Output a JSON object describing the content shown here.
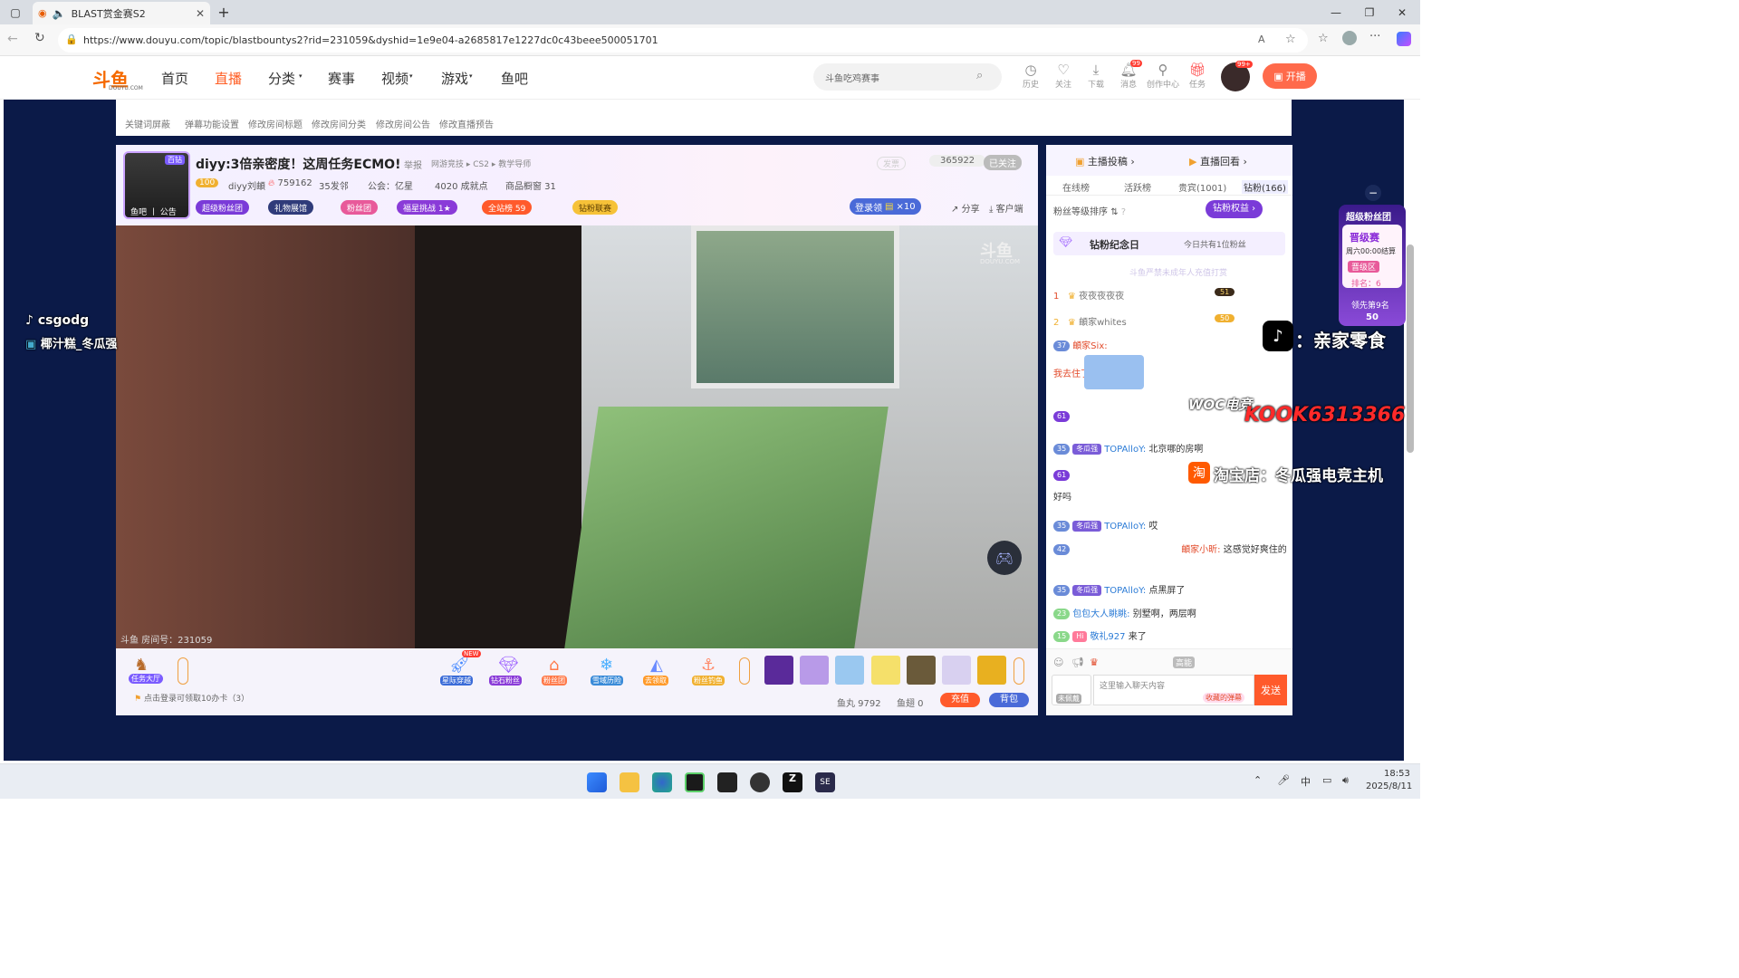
{
  "browser": {
    "tab_title": "BLAST赏金赛S2",
    "url": "https://www.douyu.com/topic/blastbountys2?rid=231059&dyshid=1e9e04-a2685817e1227dc0c43beee500051701"
  },
  "site": {
    "logo": "斗鱼",
    "logo_sub": "DOUYU.COM",
    "nav": [
      "首页",
      "直播",
      "分类",
      "赛事",
      "视频",
      "游戏",
      "鱼吧"
    ],
    "search_placeholder": "斗鱼吃鸡赛事",
    "header_icons": [
      "历史",
      "关注",
      "下载",
      "消息",
      "创作中心",
      "任务"
    ],
    "msg_badge": "99",
    "avatar_badge": "99+",
    "broadcast_btn": "开播"
  },
  "toolrow": [
    "关键词屏蔽",
    "弹幕功能设置",
    "修改房间标题",
    "修改房间分类",
    "修改房间公告",
    "修改直播预告"
  ],
  "room": {
    "title": "diyy:3倍亲密度！这周任务ECMO!",
    "report": "举报",
    "category": "网游竞技 ▸ CS2 ▸ 教学导师",
    "anchor_badge": "百钻",
    "anchor_tabs": "鱼吧 丨 公告",
    "level": "100",
    "anchor_name": "diyy刘頔",
    "hot": "759162",
    "fans_groups": "35发邻",
    "guild": "公会：亿星",
    "achievement": "4020 成就点",
    "shop": "商品橱窗 31",
    "follow_count": "365922",
    "followed": "已关注",
    "vote": "发票",
    "pills": [
      "超级粉丝团",
      "礼物展馆",
      "粉丝团",
      "福星挑战  1★",
      "全站榜   59",
      "钻粉联赛"
    ],
    "login_get": "登录领",
    "x10": "×10",
    "share": "分享",
    "client": "客户端",
    "room_no": "斗鱼 房间号：231059",
    "watermark": "斗鱼",
    "watermark_sub": "DOUYU.COM"
  },
  "bottom": {
    "task_hall": "任务大厅",
    "items": [
      "星际穿越",
      "钻石粉丝",
      "粉丝团",
      "雪域历险",
      "去领取",
      "粉丝钓鱼"
    ],
    "new_tag": "NEW",
    "login_hint": "点击登录可领取10办卡（3）",
    "yuwan": "鱼丸 9792",
    "yuchi": "鱼翅 0",
    "recharge": "充值",
    "backpack": "背包"
  },
  "side": {
    "tab_top": [
      "主播投稿",
      "直播回看"
    ],
    "tabs": [
      "在线榜",
      "活跃榜",
      "贵宾(1001)",
      "钻粉(166)"
    ],
    "fan_sort": "粉丝等级排序",
    "diamond_rights": "钻粉权益",
    "memorial": "钻粉纪念日",
    "memorial_right": "今日共有1位粉丝",
    "watermark_tip": "斗鱼严禁未成年人充值打赏",
    "rank": [
      {
        "no": "1",
        "name": "夜夜夜夜夜",
        "lv": "51"
      },
      {
        "no": "2",
        "name": "頔家whites",
        "lv": "50"
      }
    ],
    "chat": [
      {
        "lv": "37",
        "name": "頔家Six:",
        "text": "我去住了"
      },
      {
        "lv": "61",
        "name": "",
        "text": ""
      },
      {
        "lv": "35",
        "fb": "冬瓜强",
        "name": "TOPAlloY:",
        "text": "北京哪的房啊"
      },
      {
        "lv": "61",
        "name": "",
        "text": "好吗"
      },
      {
        "lv": "35",
        "fb": "冬瓜强",
        "name": "TOPAlloY:",
        "text": "哎"
      },
      {
        "lv": "42",
        "name": "頔家小昕:",
        "text": "这感觉好爽住的"
      },
      {
        "lv": "35",
        "fb": "冬瓜强",
        "name": "TOPAlloY:",
        "text": "点黑屏了"
      },
      {
        "lv": "23",
        "name": "包包大人眺眺:",
        "text": "别墅啊，两层啊"
      },
      {
        "lv": "15",
        "name": "敬礼927",
        "text": "来了"
      }
    ],
    "input_placeholder": "这里输入聊天内容",
    "input_tag": "收藏的弹幕",
    "send": "发送",
    "not_logged": "未佩戴"
  },
  "overlay": {
    "left1": "csgodg",
    "left2": "椰汁糕_冬瓜强",
    "right_tiktok": "：亲家零食",
    "woc": "WOC电竞",
    "kook": "KOOK6313366",
    "taobao": "淘宝店：冬瓜强电竞主机",
    "super_fan": "超级粉丝团",
    "promo": "晋级赛",
    "promo_time": "周六00:00结算",
    "promo_zone": "晋级区",
    "promo_rank": "排名：6",
    "lead": "领先第9名",
    "lead_num": "50"
  },
  "taskbar": {
    "time": "18:53",
    "date": "2025/8/11",
    "ime": "中"
  }
}
